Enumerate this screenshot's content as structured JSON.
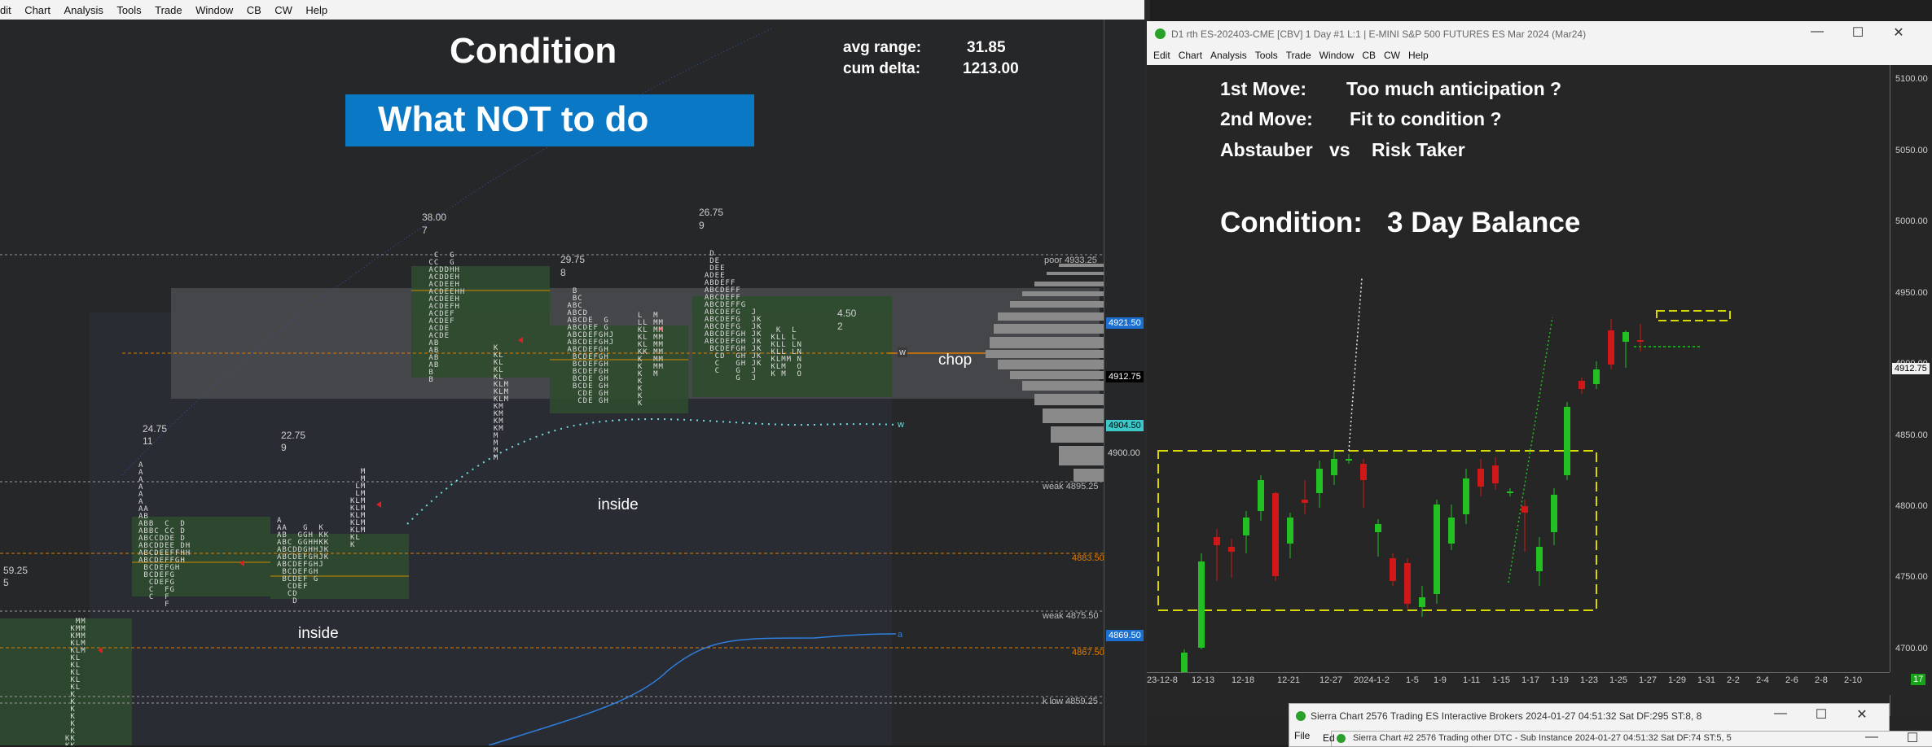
{
  "left_window": {
    "menu": [
      "dit",
      "Chart",
      "Analysis",
      "Tools",
      "Trade",
      "Window",
      "CB",
      "CW",
      "Help"
    ],
    "headline": "Condition",
    "subheadline": "What  NOT  to do",
    "stats": {
      "avg_range_label": "avg range:",
      "avg_range_value": "31.85",
      "cum_delta_label": "cum delta:",
      "cum_delta_value": "1213.00"
    },
    "annotations": {
      "chop": "chop",
      "inside_upper": "inside",
      "inside_lower": "inside"
    },
    "profile_labels": [
      {
        "value": "38.00",
        "count": "7"
      },
      {
        "value": "29.75",
        "count": "8"
      },
      {
        "value": "26.75",
        "count": "9"
      },
      {
        "value": "24.75",
        "count": "11"
      },
      {
        "value": "22.75",
        "count": "9"
      },
      {
        "value": "59.25",
        "count": "5"
      },
      {
        "value": "4.50",
        "count": "2"
      }
    ],
    "level_labels": {
      "poor": "poor 4933.25",
      "weak_upper": "weak 4895.25",
      "level_4883": "4883.50",
      "weak_lower": "weak 4875.50",
      "level_4867": "4867.50",
      "low": "k low 4859.25"
    },
    "price_badges": {
      "p1": "4921.50",
      "p2": "4912.75",
      "p3": "4904.50",
      "p4": "4900.00",
      "p5": "4869.50"
    },
    "markers": {
      "w1": "w",
      "w2": "w",
      "a": "a"
    }
  },
  "right_window": {
    "title": "D1 rth ES-202403-CME [CBV]  1 Day  #1 L:1 | E-MINI S&P 500 FUTURES ES Mar 2024 (Mar24)",
    "menu": [
      "Edit",
      "Chart",
      "Analysis",
      "Tools",
      "Trade",
      "Window",
      "CB",
      "CW",
      "Help"
    ],
    "notes": {
      "move1_label": "1st Move:",
      "move1_text": "Too much anticipation ?",
      "move2_label": "2nd Move:",
      "move2_text": "Fit to condition ?",
      "style_left": "Abstauber",
      "style_vs": "vs",
      "style_right": "Risk Taker",
      "condition_label": "Condition:",
      "condition_value": "3 Day Balance"
    },
    "price_axis": [
      "5100.00",
      "5050.00",
      "5000.00",
      "4950.00",
      "4900.00",
      "4850.00",
      "4800.00",
      "4750.00",
      "4700.00"
    ],
    "current_price": "4912.75",
    "date_axis": [
      "23-12-8",
      "12-13",
      "12-18",
      "12-21",
      "12-27",
      "2024-1-2",
      "1-5",
      "1-9",
      "1-11",
      "1-15",
      "1-17",
      "1-19",
      "1-23",
      "1-25",
      "1-27",
      "1-29",
      "1-31",
      "2-2",
      "2-4",
      "2-6",
      "2-8",
      "2-10"
    ],
    "bar_count": "17"
  },
  "taskbar_windows": [
    {
      "title": "Sierra Chart 2576 Trading ES Interactive Brokers 2024-01-27  04:51:32 Sat  DF:295  ST:8, 8",
      "menu_first": "File"
    },
    {
      "title": "Sierra Chart #2 2576 Trading other DTC - Sub Instance 2024-01-27  04:51:32 Sat  DF:74  ST:5, 5",
      "menu_first": "Ed"
    }
  ],
  "colors": {
    "accent_blue": "#0a78c4",
    "green_candle": "#22c022",
    "red_candle": "#d01818",
    "yellow_box": "#d8d800",
    "green_zone": "#2e4b2e",
    "value_area": "#4a4c4f",
    "orange_line": "#e07b00",
    "teal_dots": "#6ee0e0"
  }
}
